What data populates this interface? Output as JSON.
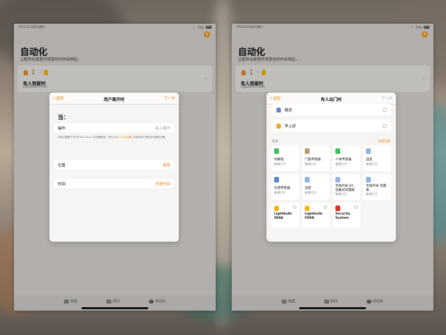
{
  "status": {
    "time": "下午1:23",
    "date": "4月5日周二",
    "battery": "71%"
  },
  "home": {
    "title": "自动化",
    "subtitle": "让配件在家居环境变化时作出响应。",
    "automation": {
      "name": "有人到家时",
      "device": "Lightbulb-FDEB"
    }
  },
  "tabs": [
    "家庭",
    "房间",
    "自动化"
  ],
  "left_modal": {
    "back": "返回",
    "title": "用户离开时",
    "next": "下一步",
    "when": "当：",
    "op_label": "操作",
    "op_value": "有人离开",
    "note_text": "您的位置基于您 的 iPod touch 的位置确定。您可以在",
    "note_link": "iCloud设置",
    "note_text_end": "中更改用于确定您位置的设备。",
    "loc_label": "位置",
    "loc_value": "家庭",
    "time_label": "时间",
    "time_value": "任意时间"
  },
  "right_modal": {
    "back": "返回",
    "title": "有人出门时",
    "next": "下一步",
    "scenes": [
      "晚安",
      "早上好"
    ],
    "section_label": "房间",
    "section_action": "添加全部",
    "tiles": [
      {
        "name": "动静贴",
        "state": "触摸打开",
        "icon": "motion-sensor-icon",
        "color": "green"
      },
      {
        "name": "门窗传感器",
        "state": "触摸打开",
        "icon": "door-sensor-icon",
        "color": "tan"
      },
      {
        "name": "人体传感器",
        "state": "触摸打开",
        "icon": "occupancy-sensor-icon",
        "color": "green"
      },
      {
        "name": "温度",
        "state": "触摸打开",
        "icon": "temperature-icon",
        "color": "blue"
      },
      {
        "name": "光感传感器",
        "state": "触摸打开",
        "icon": "light-sensor-icon",
        "color": "grey"
      },
      {
        "name": "湿度",
        "state": "触摸打开",
        "icon": "humidity-icon",
        "color": "blue"
      },
      {
        "name": "无线开关 D1 轻触式双键版",
        "state": "触摸打开",
        "icon": "switch-icon",
        "color": "blue"
      },
      {
        "name": "无线开关 双键版",
        "state": "触摸打开",
        "icon": "switch-icon",
        "color": "blue"
      }
    ],
    "accessories": [
      {
        "name": "Lightbulb-0E8A",
        "icon": "bulb-icon"
      },
      {
        "name": "Lightbulb-FDEB",
        "icon": "bulb-icon"
      },
      {
        "name": "Security System",
        "icon": "alarm-icon"
      }
    ]
  }
}
